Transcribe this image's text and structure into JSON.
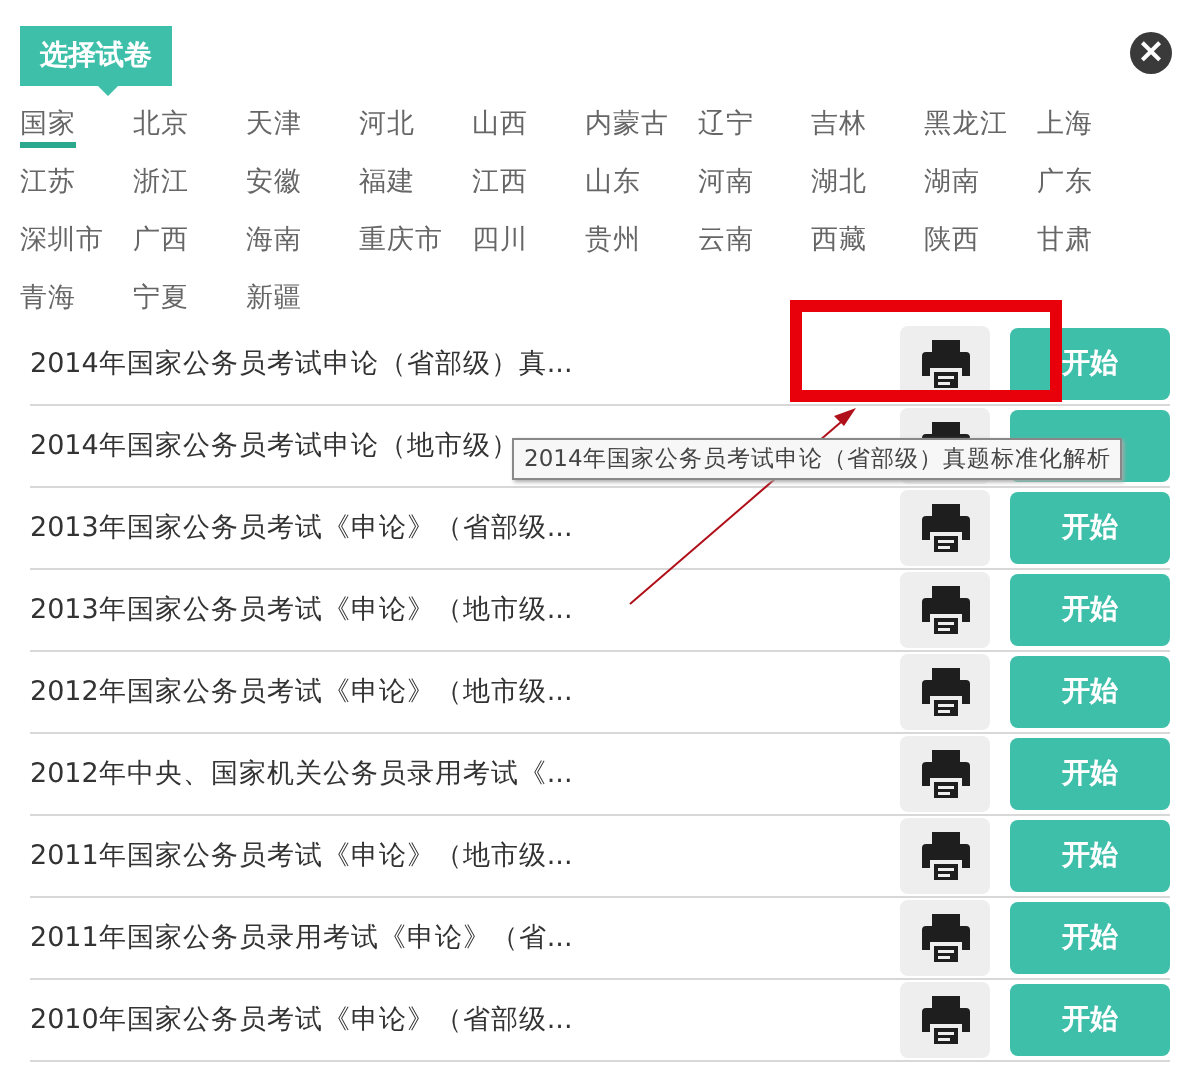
{
  "header": {
    "tag": "选择试卷",
    "close_icon": "×"
  },
  "regions": [
    {
      "label": "国家",
      "selected": true
    },
    {
      "label": "北京",
      "selected": false
    },
    {
      "label": "天津",
      "selected": false
    },
    {
      "label": "河北",
      "selected": false
    },
    {
      "label": "山西",
      "selected": false
    },
    {
      "label": "内蒙古",
      "selected": false
    },
    {
      "label": "辽宁",
      "selected": false
    },
    {
      "label": "吉林",
      "selected": false
    },
    {
      "label": "黑龙江",
      "selected": false
    },
    {
      "label": "上海",
      "selected": false
    },
    {
      "label": "江苏",
      "selected": false
    },
    {
      "label": "浙江",
      "selected": false
    },
    {
      "label": "安徽",
      "selected": false
    },
    {
      "label": "福建",
      "selected": false
    },
    {
      "label": "江西",
      "selected": false
    },
    {
      "label": "山东",
      "selected": false
    },
    {
      "label": "河南",
      "selected": false
    },
    {
      "label": "湖北",
      "selected": false
    },
    {
      "label": "湖南",
      "selected": false
    },
    {
      "label": "广东",
      "selected": false
    },
    {
      "label": "深圳市",
      "selected": false
    },
    {
      "label": "广西",
      "selected": false
    },
    {
      "label": "海南",
      "selected": false
    },
    {
      "label": "重庆市",
      "selected": false
    },
    {
      "label": "四川",
      "selected": false
    },
    {
      "label": "贵州",
      "selected": false
    },
    {
      "label": "云南",
      "selected": false
    },
    {
      "label": "西藏",
      "selected": false
    },
    {
      "label": "陕西",
      "selected": false
    },
    {
      "label": "甘肃",
      "selected": false
    },
    {
      "label": "青海",
      "selected": false
    },
    {
      "label": "宁夏",
      "selected": false
    },
    {
      "label": "新疆",
      "selected": false
    }
  ],
  "papers": [
    {
      "title": "2014年国家公务员考试申论（省部级）真...",
      "button": "开始"
    },
    {
      "title": "2014年国家公务员考试申论（地市级）"
    },
    {
      "title": "2013年国家公务员考试《申论》（省部级...",
      "button": "开始"
    },
    {
      "title": "2013年国家公务员考试《申论》（地市级...",
      "button": "开始"
    },
    {
      "title": "2012年国家公务员考试《申论》（地市级...",
      "button": "开始"
    },
    {
      "title": "2012年中央、国家机关公务员录用考试《...",
      "button": "开始"
    },
    {
      "title": "2011年国家公务员考试《申论》（地市级...",
      "button": "开始"
    },
    {
      "title": "2011年国家公务员录用考试《申论》（省...",
      "button": "开始"
    },
    {
      "title": "2010年国家公务员考试《申论》（省部级...",
      "button": "开始"
    }
  ],
  "tooltip": "2014年国家公务员考试申论（省部级）真题标准化解析"
}
